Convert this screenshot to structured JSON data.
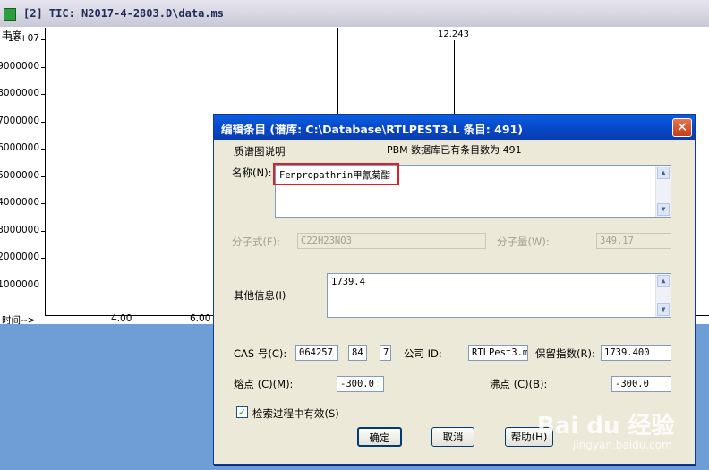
{
  "background_window": {
    "title": "[2] TIC: N2017-4-2803.D\\data.ms",
    "y_axis_title": "丰度",
    "y_labels": [
      "1e+07",
      "9000000",
      "8000000",
      "7000000",
      "6000000",
      "5000000",
      "4000000",
      "3000000",
      "2000000",
      "1000000"
    ],
    "x_axis_title": "时间-->",
    "x_labels": [
      "4.00",
      "6.00"
    ],
    "peak_label": "12.243"
  },
  "dialog": {
    "title": "编辑条目 (谱库: C:\\Database\\RTLPEST3.L 条目: 491)",
    "close_glyph": "✕",
    "section_label": "质谱图说明",
    "db_info": "PBM 数据库已有条目数为 491",
    "name_label": "名称(N):",
    "name_value": "Fenpropathrin甲氰菊酯",
    "formula_label": "分子式(F):",
    "formula_value": "C22H23NO3",
    "mw_label": "分子量(W):",
    "mw_value": "349.17",
    "other_label": "其他信息(I)",
    "other_value": "1739.4",
    "cas_label": "CAS 号(C):",
    "cas_1": "064257",
    "cas_2": "84",
    "cas_3": "7",
    "company_label": "公司 ID:",
    "company_value": "RTLPest3.m",
    "ri_label": "保留指数(R):",
    "ri_value": "1739.400",
    "mp_label": "熔点 (C)(M):",
    "mp_value": "-300.0",
    "bp_label": "沸点 (C)(B):",
    "bp_value": "-300.0",
    "search_valid_label": "检索过程中有效(S)",
    "search_valid_checked": true,
    "ok_label": "确定",
    "cancel_label": "取消",
    "help_label": "帮助(H)"
  },
  "watermark": {
    "brand": "Bai du 经验",
    "site": "jingyan.baidu.com"
  }
}
